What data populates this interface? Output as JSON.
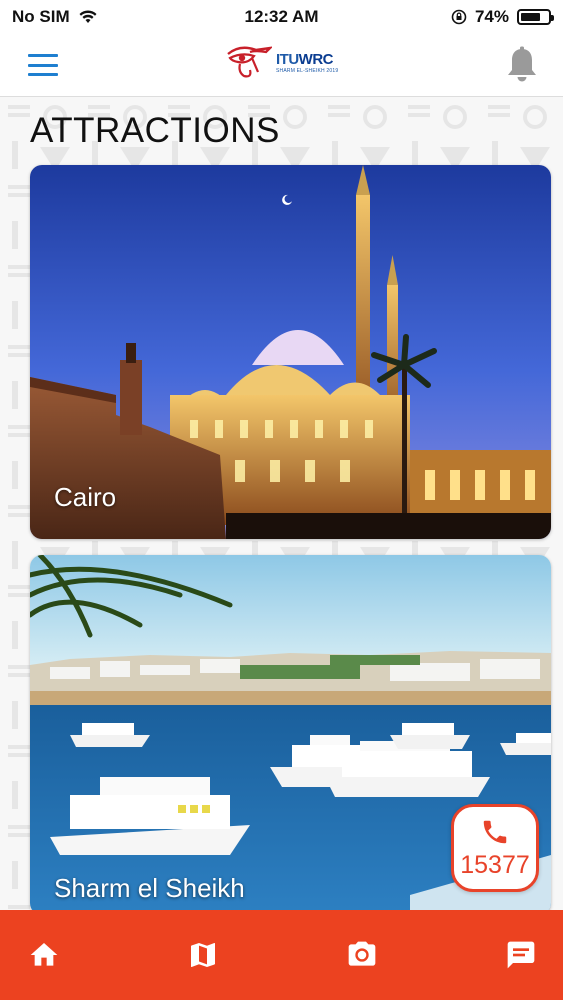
{
  "status_bar": {
    "carrier": "No SIM",
    "time": "12:32 AM",
    "battery": "74%",
    "battery_level": 0.74
  },
  "header": {
    "logo_title": "ITU",
    "logo_title_b": "WRC",
    "logo_sub": "SHARM EL-SHEIKH 2019",
    "menu_icon": "hamburger-menu-icon",
    "notifications_icon": "bell-icon"
  },
  "main": {
    "section_title": "ATTRACTIONS",
    "attractions": [
      {
        "name": "Cairo"
      },
      {
        "name": "Sharm el Sheikh"
      }
    ]
  },
  "call_button": {
    "icon": "phone-icon",
    "number": "15377"
  },
  "bottom_nav": [
    {
      "icon": "home-icon"
    },
    {
      "icon": "map-icon"
    },
    {
      "icon": "camera-icon"
    },
    {
      "icon": "message-icon"
    }
  ],
  "colors": {
    "accent": "#ec4220",
    "menu_blue": "#1e7fd0",
    "bell_gray": "#9a9a9a"
  }
}
